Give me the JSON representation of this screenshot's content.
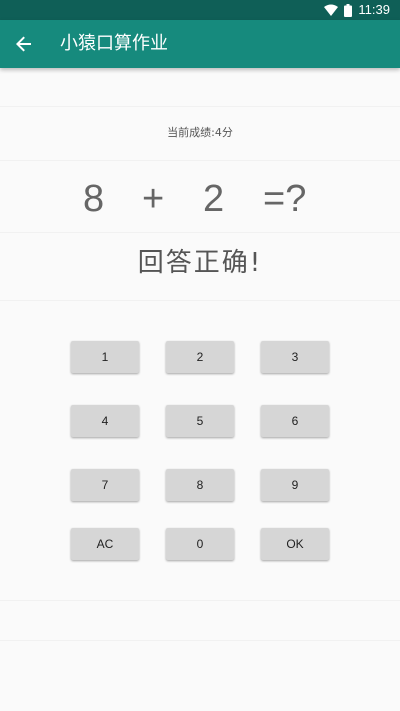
{
  "status_bar": {
    "time": "11:39",
    "icons": [
      "wifi-icon",
      "battery-icon"
    ]
  },
  "app_bar": {
    "title": "小猿口算作业",
    "back_icon": "arrow-left-icon"
  },
  "score": {
    "text": "当前成绩:4分"
  },
  "equation": {
    "operand_a": "8",
    "operator": "+",
    "operand_b": "2",
    "equals": "=?"
  },
  "result": {
    "text": "回答正确!"
  },
  "keypad": {
    "keys": [
      "1",
      "2",
      "3",
      "4",
      "5",
      "6",
      "7",
      "8",
      "9",
      "AC",
      "0",
      "OK"
    ]
  },
  "colors": {
    "status_bar": "#0f5f57",
    "app_bar": "#168a7d",
    "background": "#fafafa",
    "key": "#d6d6d6"
  }
}
